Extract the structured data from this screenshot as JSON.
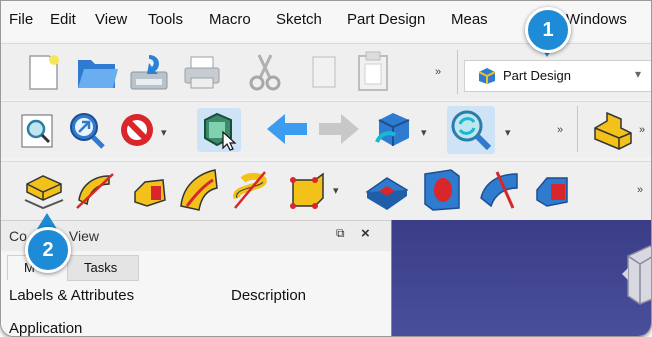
{
  "menu": {
    "items": [
      "File",
      "Edit",
      "View",
      "Tools",
      "Macro",
      "Sketch",
      "Part Design",
      "Meas",
      "Windows"
    ]
  },
  "workbench_selector": {
    "selected": "Part Design",
    "icon": "part-design-workbench-icon"
  },
  "toolbar_overflow": "»",
  "dropdown_arrow": "▾",
  "combo_view": {
    "title_left": "Co",
    "title_right": "View",
    "tabs": [
      "M",
      "Tasks"
    ],
    "float_icon": "⧉",
    "close_icon": "×",
    "columns": [
      "Labels & Attributes",
      "Description"
    ],
    "first_row_partial": "Application"
  },
  "callouts": [
    {
      "number": "1",
      "target": "workbench-selector"
    },
    {
      "number": "2",
      "target": "pad-tool"
    }
  ],
  "colors": {
    "callout": "#1d8bd6",
    "viewport_bg": "#3f4390",
    "toolbar_bg": "#efefef",
    "part_yellow": "#f2c21b",
    "part_red": "#d9262b",
    "nav_blue": "#2e6fc2"
  }
}
